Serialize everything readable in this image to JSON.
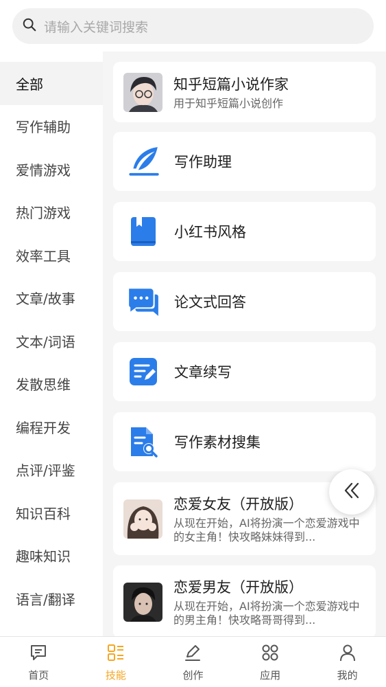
{
  "search": {
    "placeholder": "请输入关键词搜索"
  },
  "sidebar": {
    "items": [
      {
        "label": "全部",
        "active": true
      },
      {
        "label": "写作辅助"
      },
      {
        "label": "爱情游戏"
      },
      {
        "label": "热门游戏"
      },
      {
        "label": "效率工具"
      },
      {
        "label": "文章/故事"
      },
      {
        "label": "文本/词语"
      },
      {
        "label": "发散思维"
      },
      {
        "label": "编程开发"
      },
      {
        "label": "点评/评鉴"
      },
      {
        "label": "知识百科"
      },
      {
        "label": "趣味知识"
      },
      {
        "label": "语言/翻译"
      }
    ]
  },
  "cards": [
    {
      "title": "知乎短篇小说作家",
      "desc": "用于知乎短篇小说创作",
      "icon": "avatar-boy-glasses"
    },
    {
      "title": "写作助理",
      "icon": "feather-icon"
    },
    {
      "title": "小红书风格",
      "icon": "book-icon"
    },
    {
      "title": "论文式回答",
      "icon": "chat-bubbles-icon"
    },
    {
      "title": "文章续写",
      "icon": "edit-document-icon"
    },
    {
      "title": "写作素材搜集",
      "icon": "document-search-icon"
    },
    {
      "title": "恋爱女友（开放版）",
      "desc": "从现在开始，AI将扮演一个恋爱游戏中的女主角！快攻略妹妹得到...",
      "icon": "avatar-girl"
    },
    {
      "title": "恋爱男友（开放版）",
      "desc": "从现在开始，AI将扮演一个恋爱游戏中的男主角！快攻略哥哥得到...",
      "icon": "avatar-boy"
    }
  ],
  "tabbar": {
    "tabs": [
      {
        "label": "首页",
        "icon": "message-icon"
      },
      {
        "label": "技能",
        "icon": "skills-icon",
        "active": true
      },
      {
        "label": "创作",
        "icon": "pen-icon"
      },
      {
        "label": "应用",
        "icon": "apps-icon"
      },
      {
        "label": "我的",
        "icon": "user-icon"
      }
    ]
  },
  "colors": {
    "accent": "#f5a623",
    "icon_blue": "#2b7de9"
  }
}
